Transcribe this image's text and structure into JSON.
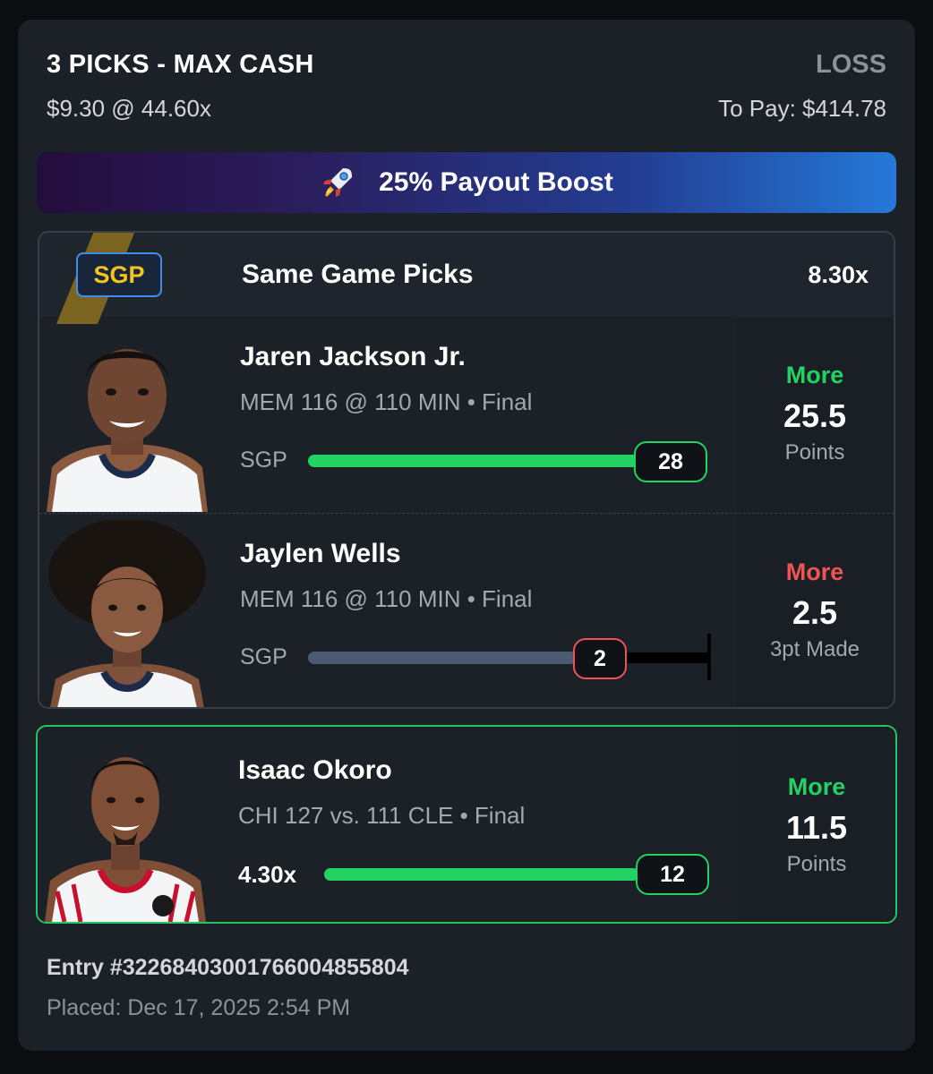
{
  "header": {
    "title": "3 PICKS - MAX CASH",
    "status": "LOSS",
    "wager": "$9.30 @ 44.60x",
    "to_pay": "To Pay: $414.78"
  },
  "boost": {
    "label": "25% Payout Boost",
    "icon": "rocket-icon"
  },
  "sgp": {
    "badge": "SGP",
    "title": "Same Game Picks",
    "multiplier": "8.30x",
    "picks": [
      {
        "player": "Jaren Jackson Jr.",
        "game": "MEM 116 @ 110 MIN • Final",
        "tag": "SGP",
        "direction": "More",
        "direction_color": "#22d262",
        "line": "25.5",
        "stat": "Points",
        "actual": "28",
        "progress": 1.0,
        "result": "hit"
      },
      {
        "player": "Jaylen Wells",
        "game": "MEM 116 @ 110 MIN • Final",
        "tag": "SGP",
        "direction": "More",
        "direction_color": "#ef5454",
        "line": "2.5",
        "stat": "3pt Made",
        "actual": "2",
        "progress": 0.8,
        "result": "miss"
      }
    ]
  },
  "single": {
    "player": "Isaac Okoro",
    "game": "CHI 127 vs. 111 CLE • Final",
    "multiplier": "4.30x",
    "direction": "More",
    "direction_color": "#22d262",
    "line": "11.5",
    "stat": "Points",
    "actual": "12",
    "progress": 1.0,
    "result": "hit"
  },
  "footer": {
    "entry": "Entry #3226840300176600485580​4",
    "placed": "Placed: Dec 17, 2025 2:54 PM"
  }
}
